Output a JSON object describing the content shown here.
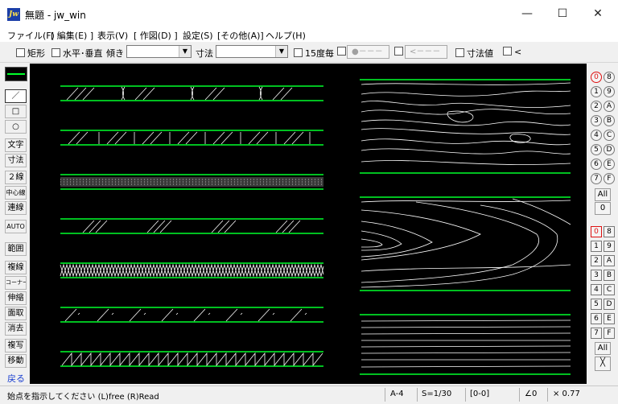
{
  "window": {
    "title": "無題 - jw_win",
    "icon": "jw-app-icon",
    "minimize": "—",
    "maximize": "☐",
    "close": "✕"
  },
  "menu": [
    "ファイル(F)",
    "[ 編集(E) ]",
    "表示(V)",
    "[ 作図(D) ]",
    "設定(S)",
    "[その他(A)]",
    "ヘルプ(H)"
  ],
  "toolbar": {
    "rect": "矩形",
    "hv": "水平･垂直",
    "tilt": "傾き",
    "tilt_value": "",
    "dim": "寸法",
    "dim_value": "",
    "deg15": "15度毎",
    "dot_btn": "●－－－",
    "arrow_btn": "<－－－",
    "dim_value_label": "寸法値",
    "less": "<"
  },
  "left_tools": [
    "／",
    "□",
    "○",
    "文字",
    "寸法",
    "２線",
    "中心線",
    "連線",
    "AUTO",
    "範囲",
    "複線",
    "コーナー",
    "伸縮",
    "面取",
    "消去",
    "複写",
    "移動"
  ],
  "left_return": "戻る",
  "layers_top": [
    [
      "0",
      "8"
    ],
    [
      "1",
      "9"
    ],
    [
      "2",
      "A"
    ],
    [
      "3",
      "B"
    ],
    [
      "4",
      "C"
    ],
    [
      "5",
      "D"
    ],
    [
      "6",
      "E"
    ],
    [
      "7",
      "F"
    ]
  ],
  "layers_top_all": "All",
  "layers_top_zero": "0",
  "layers_bottom": [
    [
      "0",
      "8"
    ],
    [
      "1",
      "9"
    ],
    [
      "2",
      "A"
    ],
    [
      "3",
      "B"
    ],
    [
      "4",
      "C"
    ],
    [
      "5",
      "D"
    ],
    [
      "6",
      "E"
    ],
    [
      "7",
      "F"
    ]
  ],
  "layers_bottom_all": "All",
  "layers_bottom_cross": "╳",
  "status": {
    "message": "始点を指示してください (L)free (R)Read",
    "paper": "A-4",
    "scale": "S=1/30",
    "layer": "[0-0]",
    "angle": "∠0",
    "zoom": "× 0.77"
  },
  "colors": {
    "line_green": "#00ff2a",
    "line_white": "#ffffff",
    "canvas": "#000000",
    "selected_red": "#dd1111"
  }
}
